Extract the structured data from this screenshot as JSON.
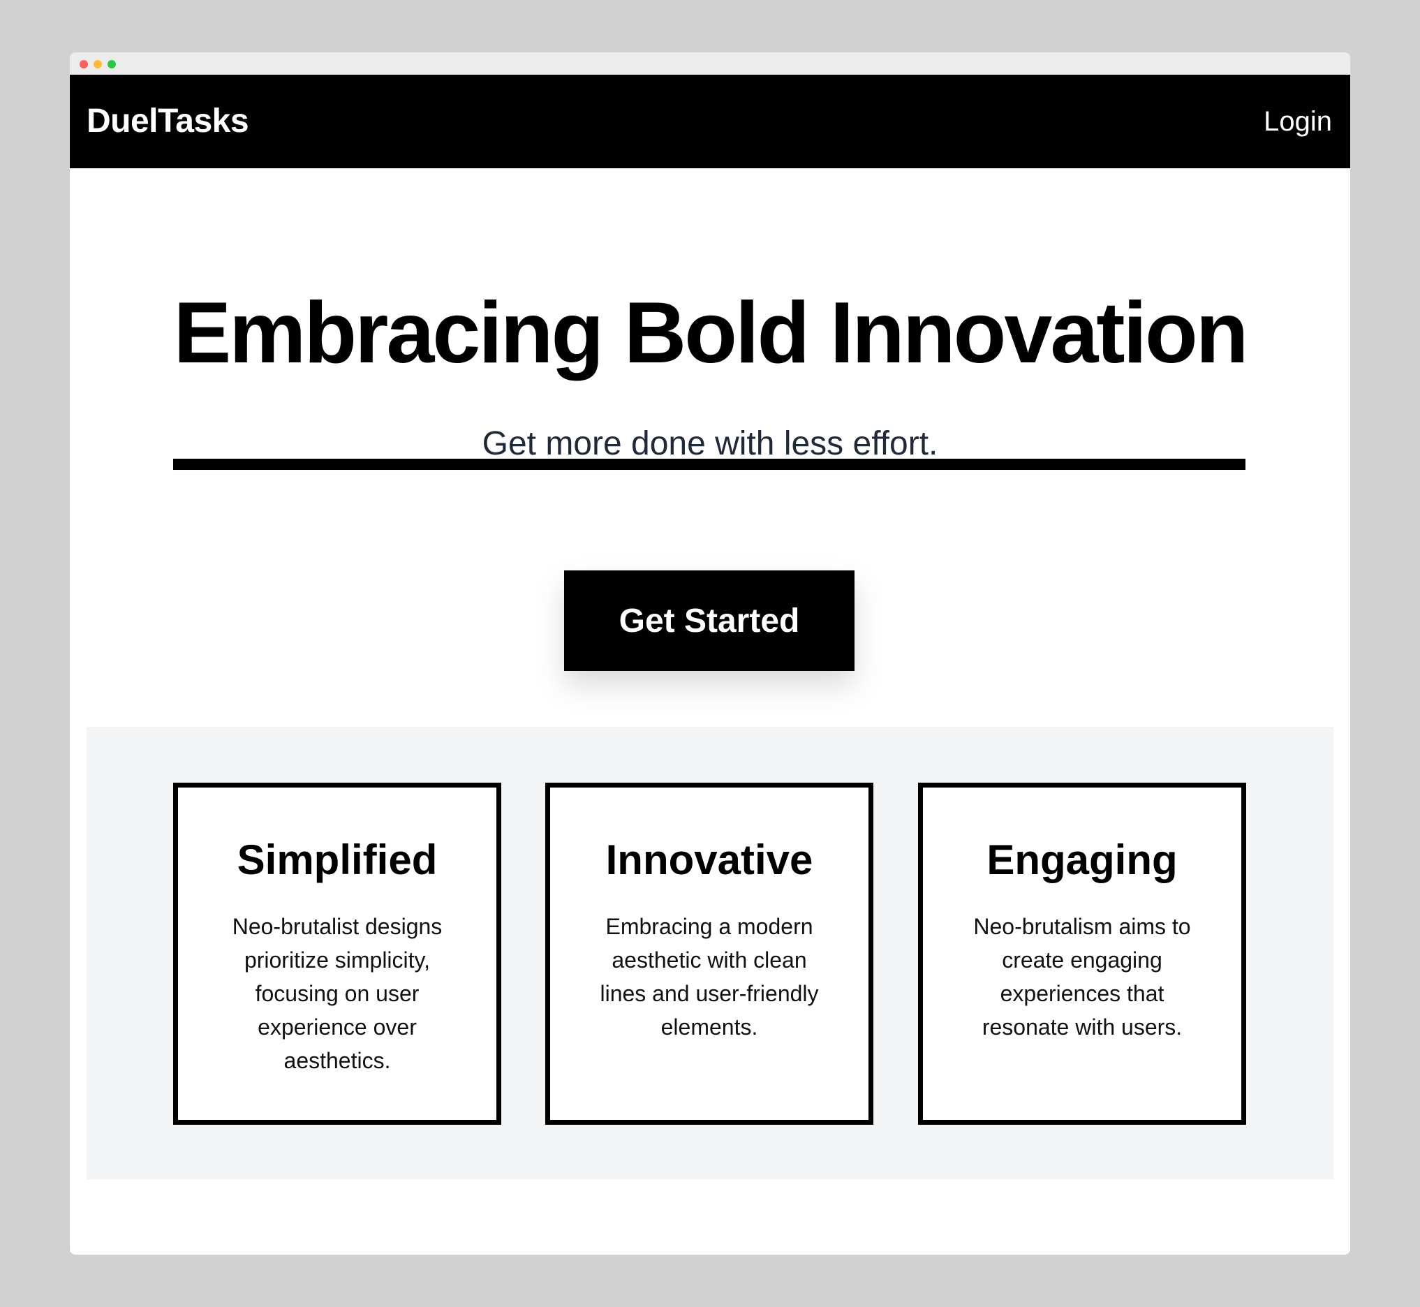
{
  "app": {
    "brand": "DuelTasks",
    "login_label": "Login"
  },
  "hero": {
    "title": "Embracing Bold Innovation",
    "subtitle": "Get more done with less effort.",
    "cta_label": "Get Started"
  },
  "features": [
    {
      "title": "Simplified",
      "text": "Neo-brutalist designs prioritize simplicity, focusing on user experience over aesthetics."
    },
    {
      "title": "Innovative",
      "text": "Embracing a modern aesthetic with clean lines and user-friendly elements."
    },
    {
      "title": "Engaging",
      "text": "Neo-brutalism aims to create engaging experiences that resonate with users."
    }
  ],
  "colors": {
    "page_background": "#d1d1d1",
    "navbar": "#000000",
    "accent": "#000000",
    "features_background": "#f3f4f6",
    "subtitle_text": "#1f2937"
  }
}
